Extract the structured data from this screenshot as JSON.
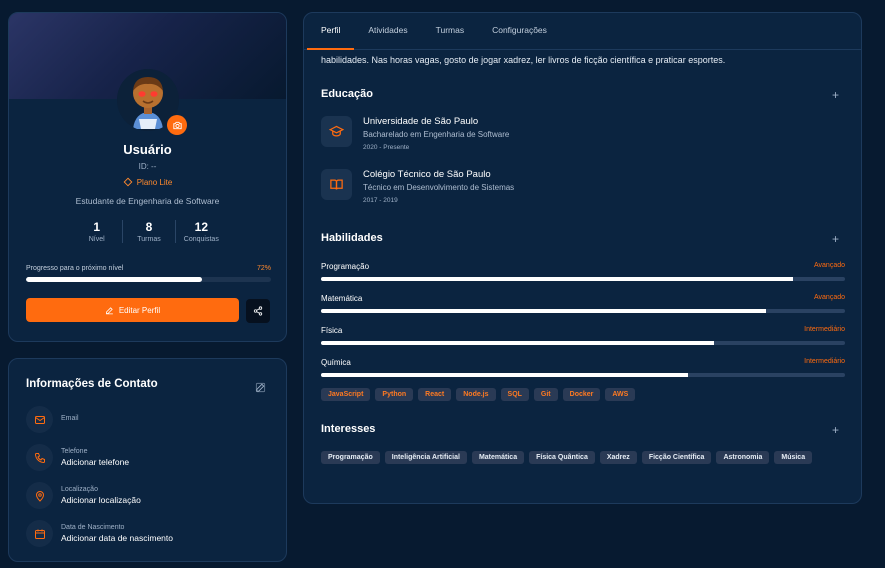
{
  "profile": {
    "name": "Usuário",
    "id_label": "ID: --",
    "plan": "Plano Lite",
    "role": "Estudante de Engenharia de Software",
    "stats": [
      {
        "value": "1",
        "label": "Nível"
      },
      {
        "value": "8",
        "label": "Turmas"
      },
      {
        "value": "12",
        "label": "Conquistas"
      }
    ],
    "progress_label": "Progresso para o próximo nível",
    "progress_text": "72%",
    "progress_value": 0.72,
    "edit_label": "Editar Perfil"
  },
  "contact": {
    "title": "Informações de Contato",
    "items": [
      {
        "label": "Email",
        "value": "",
        "icon": "mail-icon"
      },
      {
        "label": "Telefone",
        "value": "Adicionar telefone",
        "icon": "phone-icon"
      },
      {
        "label": "Localização",
        "value": "Adicionar localização",
        "icon": "map-pin-icon"
      },
      {
        "label": "Data de Nascimento",
        "value": "Adicionar data de nascimento",
        "icon": "calendar-icon"
      }
    ]
  },
  "tabs": [
    "Perfil",
    "Atividades",
    "Turmas",
    "Configurações"
  ],
  "about_text": "habilidades. Nas horas vagas, gosto de jogar xadrez, ler livros de ficção científica e praticar esportes.",
  "education": {
    "title": "Educação",
    "items": [
      {
        "institution": "Universidade de São Paulo",
        "course": "Bacharelado em Engenharia de Software",
        "period": "2020 - Presente",
        "icon": "graduation-cap-icon"
      },
      {
        "institution": "Colégio Técnico de São Paulo",
        "course": "Técnico em Desenvolvimento de Sistemas",
        "period": "2017 - 2019",
        "icon": "book-icon"
      }
    ]
  },
  "skills": {
    "title": "Habilidades",
    "items": [
      {
        "name": "Programação",
        "level": "Avançado",
        "value": 0.9
      },
      {
        "name": "Matemática",
        "level": "Avançado",
        "value": 0.85
      },
      {
        "name": "Física",
        "level": "Intermediário",
        "value": 0.75
      },
      {
        "name": "Química",
        "level": "Intermediário",
        "value": 0.7
      }
    ],
    "tech_tags": [
      "JavaScript",
      "Python",
      "React",
      "Node.js",
      "SQL",
      "Git",
      "Docker",
      "AWS"
    ]
  },
  "interests": {
    "title": "Interesses",
    "tags": [
      "Programação",
      "Inteligência Artificial",
      "Matemática",
      "Física Quântica",
      "Xadrez",
      "Ficção Científica",
      "Astronomia",
      "Música"
    ]
  },
  "colors": {
    "accent": "#ff6b0f",
    "background": "#071a30",
    "card": "#0b2440"
  }
}
